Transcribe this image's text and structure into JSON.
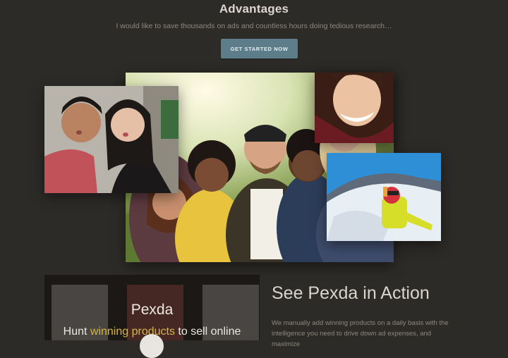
{
  "advantages": {
    "title": "Advantages",
    "subtitle": "I would like to save thousands on ads and countless hours doing tedious research…",
    "cta_label": "GET STARTED NOW"
  },
  "collage": {
    "images": [
      {
        "name": "group-selfie-photo"
      },
      {
        "name": "couple-selfie-photo"
      },
      {
        "name": "woman-smiling-photo"
      },
      {
        "name": "skier-selfie-photo"
      }
    ]
  },
  "demo_video": {
    "brand": "Pexda",
    "tagline_prefix": "Hunt ",
    "tagline_highlight": "winning products",
    "tagline_suffix": " to sell online"
  },
  "action": {
    "title": "See Pexda in Action",
    "body": "We manually add winning products on a daily basis with the intelligence you need to drive down ad expenses, and maximize"
  },
  "colors": {
    "background": "#2d2b28",
    "cta": "#5e7d8a",
    "highlight": "#d7b44a"
  }
}
